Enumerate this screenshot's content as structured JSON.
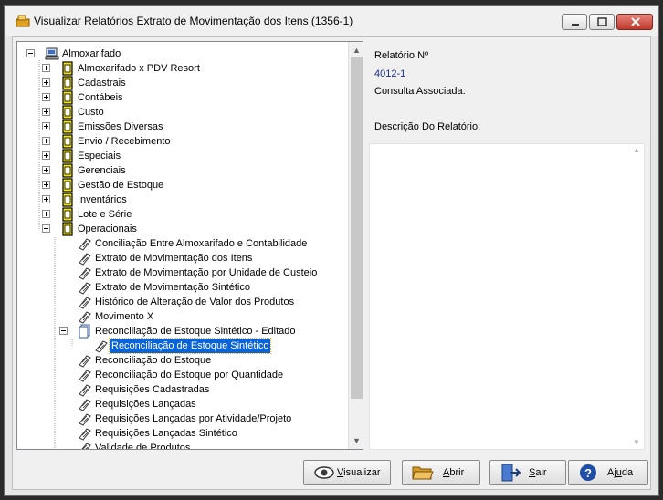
{
  "window": {
    "title": "Visualizar Relatórios Extrato de Movimentação dos Itens (1356-1)"
  },
  "tree": {
    "root": "Almoxarifado",
    "categories": [
      "Almoxarifado x PDV Resort",
      "Cadastrais",
      "Contábeis",
      "Custo",
      "Emissões Diversas",
      "Envio / Recebimento",
      "Especiais",
      "Gerenciais",
      "Gestão de Estoque",
      "Inventários",
      "Lote e Série",
      "Operacionais"
    ],
    "reports_before": [
      "Conciliação Entre Almoxarifado e Contabilidade",
      "Extrato de Movimentação dos Itens",
      "Extrato de Movimentação por Unidade de Custeio",
      "Extrato de Movimentação Sintético",
      "Histórico de Alteração de Valor dos Produtos",
      "Movimento X"
    ],
    "group_edited": "Reconciliação de Estoque Sintético - Editado",
    "selected_child": "Reconciliação de Estoque Sintético",
    "reports_after": [
      "Reconciliação do Estoque",
      "Reconciliação do Estoque por Quantidade",
      "Requisições Cadastradas",
      "Requisições Lançadas",
      "Requisições Lançadas por Atividade/Projeto",
      "Requisições Lançadas Sintético",
      "Validade de Produtos"
    ]
  },
  "details": {
    "report_number_label": "Relatório Nº",
    "report_number_value": "4012-1",
    "associated_query_label": "Consulta Associada:",
    "description_label": "Descrição Do Relatório:"
  },
  "buttons": {
    "view": {
      "pre": "",
      "key": "V",
      "post": "isualizar"
    },
    "open": {
      "pre": "",
      "key": "A",
      "post": "brir"
    },
    "exit": {
      "pre": "",
      "key": "S",
      "post": "air"
    },
    "help": {
      "pre": "Aj",
      "key": "u",
      "post": "da"
    }
  },
  "colors": {
    "selection": "#0a64d8",
    "value_text": "#1b2f8a",
    "folder_icon": "#f2e600"
  }
}
